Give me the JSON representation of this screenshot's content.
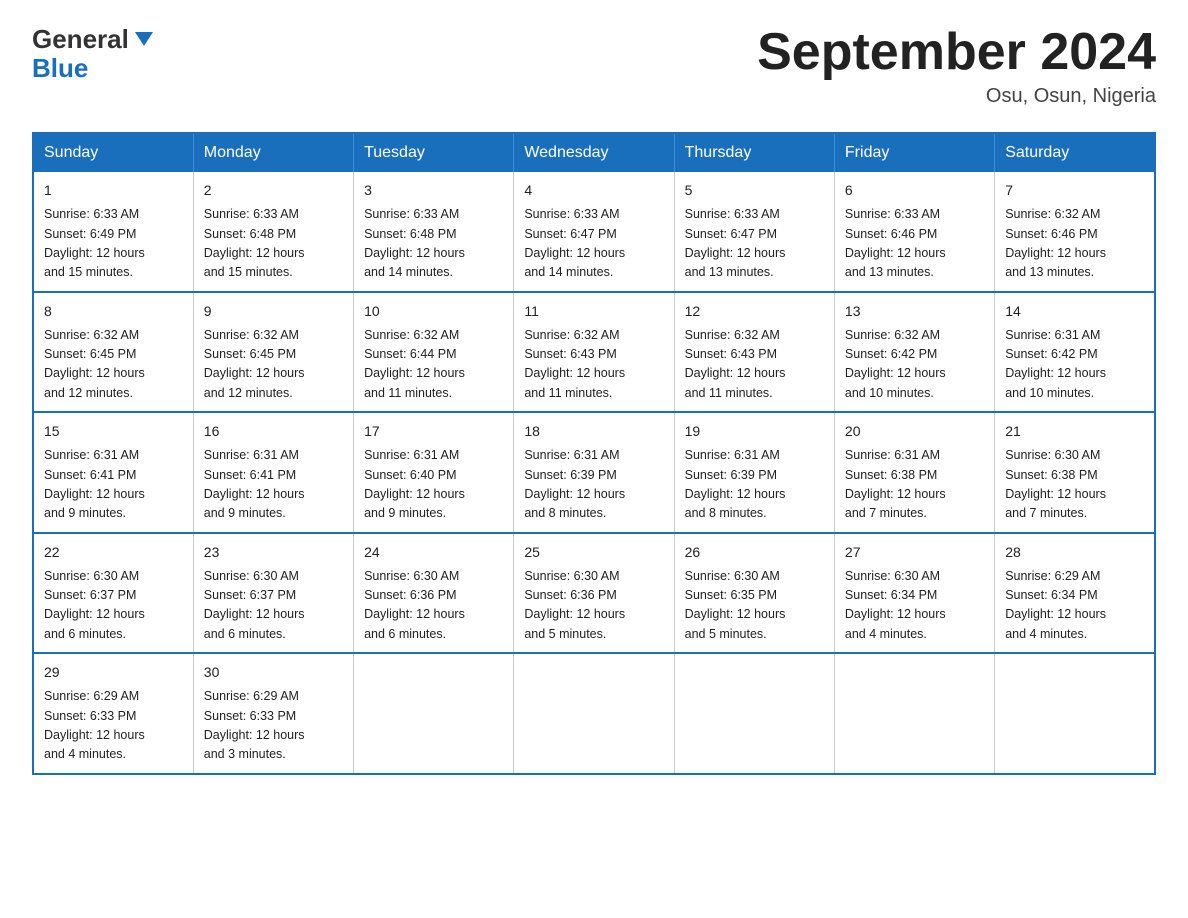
{
  "header": {
    "logo_line1": "General",
    "logo_line2": "Blue",
    "month_title": "September 2024",
    "location": "Osu, Osun, Nigeria"
  },
  "weekdays": [
    "Sunday",
    "Monday",
    "Tuesday",
    "Wednesday",
    "Thursday",
    "Friday",
    "Saturday"
  ],
  "weeks": [
    [
      {
        "day": "1",
        "sunrise": "6:33 AM",
        "sunset": "6:49 PM",
        "daylight": "12 hours and 15 minutes."
      },
      {
        "day": "2",
        "sunrise": "6:33 AM",
        "sunset": "6:48 PM",
        "daylight": "12 hours and 15 minutes."
      },
      {
        "day": "3",
        "sunrise": "6:33 AM",
        "sunset": "6:48 PM",
        "daylight": "12 hours and 14 minutes."
      },
      {
        "day": "4",
        "sunrise": "6:33 AM",
        "sunset": "6:47 PM",
        "daylight": "12 hours and 14 minutes."
      },
      {
        "day": "5",
        "sunrise": "6:33 AM",
        "sunset": "6:47 PM",
        "daylight": "12 hours and 13 minutes."
      },
      {
        "day": "6",
        "sunrise": "6:33 AM",
        "sunset": "6:46 PM",
        "daylight": "12 hours and 13 minutes."
      },
      {
        "day": "7",
        "sunrise": "6:32 AM",
        "sunset": "6:46 PM",
        "daylight": "12 hours and 13 minutes."
      }
    ],
    [
      {
        "day": "8",
        "sunrise": "6:32 AM",
        "sunset": "6:45 PM",
        "daylight": "12 hours and 12 minutes."
      },
      {
        "day": "9",
        "sunrise": "6:32 AM",
        "sunset": "6:45 PM",
        "daylight": "12 hours and 12 minutes."
      },
      {
        "day": "10",
        "sunrise": "6:32 AM",
        "sunset": "6:44 PM",
        "daylight": "12 hours and 11 minutes."
      },
      {
        "day": "11",
        "sunrise": "6:32 AM",
        "sunset": "6:43 PM",
        "daylight": "12 hours and 11 minutes."
      },
      {
        "day": "12",
        "sunrise": "6:32 AM",
        "sunset": "6:43 PM",
        "daylight": "12 hours and 11 minutes."
      },
      {
        "day": "13",
        "sunrise": "6:32 AM",
        "sunset": "6:42 PM",
        "daylight": "12 hours and 10 minutes."
      },
      {
        "day": "14",
        "sunrise": "6:31 AM",
        "sunset": "6:42 PM",
        "daylight": "12 hours and 10 minutes."
      }
    ],
    [
      {
        "day": "15",
        "sunrise": "6:31 AM",
        "sunset": "6:41 PM",
        "daylight": "12 hours and 9 minutes."
      },
      {
        "day": "16",
        "sunrise": "6:31 AM",
        "sunset": "6:41 PM",
        "daylight": "12 hours and 9 minutes."
      },
      {
        "day": "17",
        "sunrise": "6:31 AM",
        "sunset": "6:40 PM",
        "daylight": "12 hours and 9 minutes."
      },
      {
        "day": "18",
        "sunrise": "6:31 AM",
        "sunset": "6:39 PM",
        "daylight": "12 hours and 8 minutes."
      },
      {
        "day": "19",
        "sunrise": "6:31 AM",
        "sunset": "6:39 PM",
        "daylight": "12 hours and 8 minutes."
      },
      {
        "day": "20",
        "sunrise": "6:31 AM",
        "sunset": "6:38 PM",
        "daylight": "12 hours and 7 minutes."
      },
      {
        "day": "21",
        "sunrise": "6:30 AM",
        "sunset": "6:38 PM",
        "daylight": "12 hours and 7 minutes."
      }
    ],
    [
      {
        "day": "22",
        "sunrise": "6:30 AM",
        "sunset": "6:37 PM",
        "daylight": "12 hours and 6 minutes."
      },
      {
        "day": "23",
        "sunrise": "6:30 AM",
        "sunset": "6:37 PM",
        "daylight": "12 hours and 6 minutes."
      },
      {
        "day": "24",
        "sunrise": "6:30 AM",
        "sunset": "6:36 PM",
        "daylight": "12 hours and 6 minutes."
      },
      {
        "day": "25",
        "sunrise": "6:30 AM",
        "sunset": "6:36 PM",
        "daylight": "12 hours and 5 minutes."
      },
      {
        "day": "26",
        "sunrise": "6:30 AM",
        "sunset": "6:35 PM",
        "daylight": "12 hours and 5 minutes."
      },
      {
        "day": "27",
        "sunrise": "6:30 AM",
        "sunset": "6:34 PM",
        "daylight": "12 hours and 4 minutes."
      },
      {
        "day": "28",
        "sunrise": "6:29 AM",
        "sunset": "6:34 PM",
        "daylight": "12 hours and 4 minutes."
      }
    ],
    [
      {
        "day": "29",
        "sunrise": "6:29 AM",
        "sunset": "6:33 PM",
        "daylight": "12 hours and 4 minutes."
      },
      {
        "day": "30",
        "sunrise": "6:29 AM",
        "sunset": "6:33 PM",
        "daylight": "12 hours and 3 minutes."
      },
      null,
      null,
      null,
      null,
      null
    ]
  ],
  "labels": {
    "sunrise": "Sunrise:",
    "sunset": "Sunset:",
    "daylight": "Daylight:"
  }
}
